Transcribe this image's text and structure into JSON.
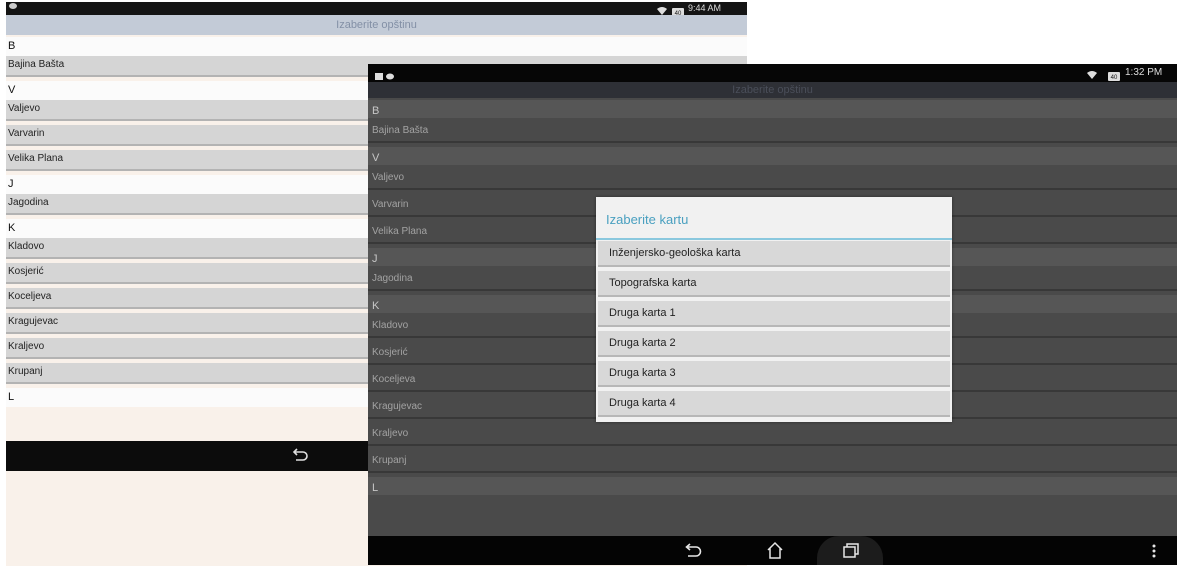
{
  "back_screen": {
    "status_bar": {
      "time": "9:44 AM",
      "battery": "40"
    },
    "title": "Izaberite opštinu",
    "list": [
      {
        "type": "header",
        "label": "B"
      },
      {
        "type": "item",
        "label": "Bajina Bašta"
      },
      {
        "type": "header",
        "label": "V"
      },
      {
        "type": "item",
        "label": "Valjevo"
      },
      {
        "type": "item",
        "label": "Varvarin"
      },
      {
        "type": "item",
        "label": "Velika Plana"
      },
      {
        "type": "header",
        "label": "J"
      },
      {
        "type": "item",
        "label": "Jagodina"
      },
      {
        "type": "header",
        "label": "K"
      },
      {
        "type": "item",
        "label": "Kladovo"
      },
      {
        "type": "item",
        "label": "Kosjerić"
      },
      {
        "type": "item",
        "label": "Koceljeva"
      },
      {
        "type": "item",
        "label": "Kragujevac"
      },
      {
        "type": "item",
        "label": "Kraljevo"
      },
      {
        "type": "item",
        "label": "Krupanj"
      },
      {
        "type": "header",
        "label": "L"
      }
    ],
    "nav": {
      "back_icon": "back-arrow-icon"
    }
  },
  "front_screen": {
    "status_bar": {
      "time": "1:32 PM",
      "battery": "40"
    },
    "title": "Izaberite opštinu",
    "list": [
      {
        "type": "header",
        "label": "B"
      },
      {
        "type": "item",
        "label": "Bajina Bašta"
      },
      {
        "type": "header",
        "label": "V"
      },
      {
        "type": "item",
        "label": "Valjevo"
      },
      {
        "type": "item",
        "label": "Varvarin"
      },
      {
        "type": "item",
        "label": "Velika Plana"
      },
      {
        "type": "header",
        "label": "J"
      },
      {
        "type": "item",
        "label": "Jagodina"
      },
      {
        "type": "header",
        "label": "K"
      },
      {
        "type": "item",
        "label": "Kladovo"
      },
      {
        "type": "item",
        "label": "Kosjerić"
      },
      {
        "type": "item",
        "label": "Koceljeva"
      },
      {
        "type": "item",
        "label": "Kragujevac"
      },
      {
        "type": "item",
        "label": "Kraljevo"
      },
      {
        "type": "item",
        "label": "Krupanj"
      },
      {
        "type": "header",
        "label": "L"
      }
    ],
    "nav": {
      "back_icon": "back-arrow-icon",
      "home_icon": "home-icon",
      "recents_icon": "recent-apps-icon",
      "menu_icon": "overflow-menu-icon"
    }
  },
  "dialog": {
    "title": "Izaberite kartu",
    "options": [
      "Inženjersko-geološka karta",
      "Topografska karta",
      "Druga karta 1",
      "Druga karta 2",
      "Druga karta 3",
      "Druga karta 4"
    ]
  },
  "colors": {
    "dialog_title": "#4aa0c0",
    "dialog_divider": "#8ac8de",
    "back_title_bar": "#c3cbd7"
  }
}
